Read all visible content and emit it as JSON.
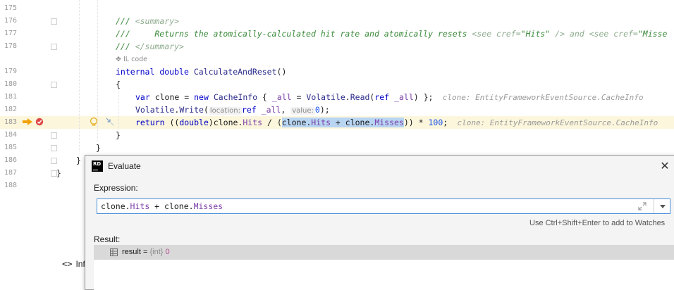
{
  "editor": {
    "lines": [
      {
        "num": "175"
      },
      {
        "num": "176",
        "code": [
          "/// ",
          "<summary>"
        ]
      },
      {
        "num": "177",
        "code": [
          "///     Returns the atomically-calculated hit rate and atomically resets ",
          "<see cref=",
          "\"Hits\"",
          " /> and ",
          "<see cref=",
          "\"Misse"
        ]
      },
      {
        "num": "178",
        "code": [
          "/// ",
          "</summary>"
        ]
      },
      {
        "num": "179",
        "code": [
          "internal",
          " ",
          "double",
          " ",
          "CalculateAndReset",
          "()"
        ]
      },
      {
        "num": "180",
        "code": [
          "{"
        ]
      },
      {
        "num": "181",
        "code": [
          "var",
          " clone = ",
          "new",
          " ",
          "CacheInfo",
          " { ",
          "_all",
          " = ",
          "Volatile",
          ".",
          "Read",
          "(",
          "ref",
          " ",
          "_all",
          ") };",
          "  clone: EntityFrameworkEventSource.CacheInfo"
        ]
      },
      {
        "num": "182",
        "code": [
          "Volatile",
          ".",
          "Write",
          "(",
          "location:",
          "ref",
          " ",
          "_all",
          ", ",
          "value:",
          "0",
          ");"
        ]
      },
      {
        "num": "183",
        "code": [
          "return",
          " ((",
          "double",
          ")clone.",
          "Hits",
          " / (",
          "clone.",
          "Hits",
          " + clone.",
          "Misses",
          ")) * ",
          "100",
          ";",
          "  clone: EntityFrameworkEventSource.CacheInfo"
        ]
      },
      {
        "num": "184",
        "code": [
          "}"
        ]
      },
      {
        "num": "185",
        "code": [
          "}"
        ]
      },
      {
        "num": "186",
        "code": [
          "}"
        ]
      },
      {
        "num": "187",
        "code": [
          "}"
        ]
      },
      {
        "num": "188"
      }
    ],
    "il_code_label": "IL code",
    "bottom_tab": {
      "icon": "<>",
      "label": "Inf"
    }
  },
  "dialog": {
    "title": "Evaluate",
    "logo_text": "RD",
    "close_glyph": "✕",
    "expression_label": "Expression:",
    "expression_value": [
      "clone.",
      "Hits",
      " + clone.",
      "Misses"
    ],
    "hint": "Use Ctrl+Shift+Enter to add to Watches",
    "result_label": "Result:",
    "result": {
      "name": "result",
      "eq": " = ",
      "type": "{int}",
      "value": "0"
    }
  },
  "colors": {
    "accent": "#4a8ed8",
    "current_line": "#fbf6dc",
    "selection": "#b8d5f2"
  }
}
